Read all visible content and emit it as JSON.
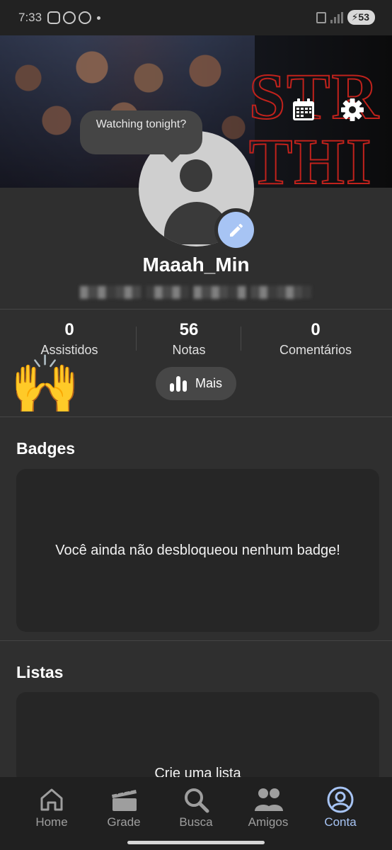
{
  "status_bar": {
    "time": "7:33",
    "battery": "53"
  },
  "profile": {
    "tooltip": "Watching tonight?",
    "username": "Maaah_Min",
    "email": "▓▒▓░▒▓▒ ░▓▒▓░ ▓▒▓▒░▓ ▒▓░▒▓▒░"
  },
  "stats": [
    {
      "value": "0",
      "label": "Assistidos"
    },
    {
      "value": "56",
      "label": "Notas"
    },
    {
      "value": "0",
      "label": "Comentários"
    }
  ],
  "more_button": {
    "label": "Mais"
  },
  "emoji": "🙌",
  "badges": {
    "title": "Badges",
    "empty_text": "Você ainda não desbloqueou nenhum badge!"
  },
  "lists": {
    "title": "Listas",
    "cta": "Crie uma lista"
  },
  "nav": [
    {
      "label": "Home",
      "icon": "home-icon"
    },
    {
      "label": "Grade",
      "icon": "clapperboard-icon"
    },
    {
      "label": "Busca",
      "icon": "search-icon"
    },
    {
      "label": "Amigos",
      "icon": "friends-icon"
    },
    {
      "label": "Conta",
      "icon": "account-icon",
      "active": true
    }
  ],
  "colors": {
    "accent": "#a7c4f4",
    "background": "#2f2f2f",
    "card": "#262626",
    "banner_title": "#c0221c"
  }
}
